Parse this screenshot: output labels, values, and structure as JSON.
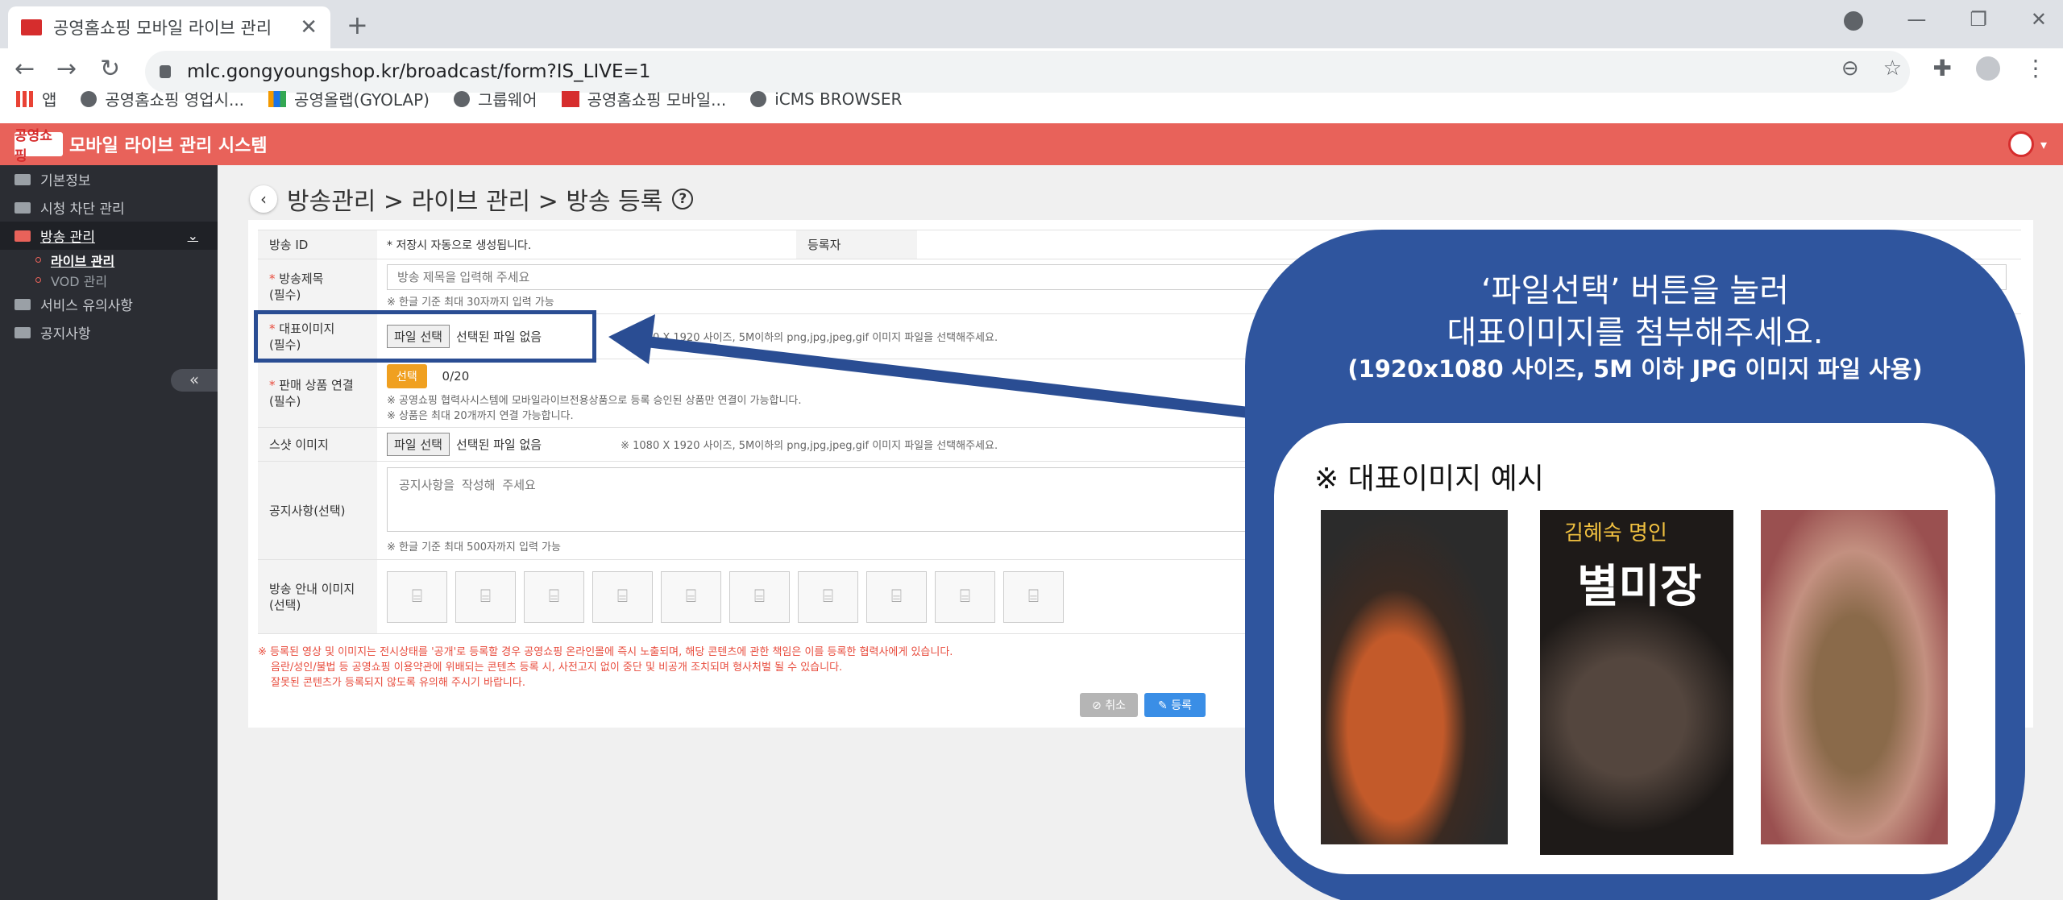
{
  "browser": {
    "tab_title": "공영홈쇼핑 모바일 라이브 관리",
    "tab_close": "✕",
    "new_tab": "+",
    "url_host": "mlc.gongyoungshop.kr",
    "url_path": "/broadcast/form?IS_LIVE=1",
    "bookmarks": [
      "앱",
      "공영홈쇼핑 영업시...",
      "공영올랩(GYOLAP)",
      "그룹웨어",
      "공영홈쇼핑 모바일...",
      "iCMS BROWSER"
    ]
  },
  "app": {
    "logo_text": "공영쇼핑",
    "title": "모바일 라이브 관리 시스템"
  },
  "sidebar": {
    "items": [
      {
        "label": "기본정보"
      },
      {
        "label": "시청 차단 관리"
      },
      {
        "label": "방송 관리",
        "chevron": "⌄"
      },
      {
        "label": "서비스 유의사항"
      },
      {
        "label": "공지사항"
      }
    ],
    "sub_items": [
      {
        "label": "라이브 관리"
      },
      {
        "label": "VOD 관리"
      }
    ],
    "collapse": "«"
  },
  "breadcrumb": "방송관리 > 라이브 관리 > 방송 등록",
  "form": {
    "broadcast_id_label": "방송 ID",
    "broadcast_id_value": "* 저장시 자동으로 생성됩니다.",
    "registrant_label": "등록자",
    "title_label_req": "*",
    "title_label": "방송제목",
    "title_label_2": "(필수)",
    "title_placeholder": "방송 제목을 입력해 주세요",
    "title_hint": "※ 한글 기준 최대 30자까지 입력 가능",
    "rep_img_label": "대표이미지",
    "rep_img_label_2": "(필수)",
    "file_button": "파일 선택",
    "no_file": "선택된 파일 없음",
    "file_hint": "※ 1080 X 1920 사이즈, 5M이하의 png,jpg,jpeg,gif 이미지 파일을 선택해주세요.",
    "product_label": "판매 상품 연결",
    "product_label_2": "(필수)",
    "select_button": "선택",
    "product_count": "0/20",
    "product_hint_1": "※ 공영쇼핑 협력사시스템에 모바일라이브전용상품으로 등록 승인된 상품만 연결이 가능합니다.",
    "product_hint_2": "※ 상품은 최대 20개까지 연결 가능합니다.",
    "snapshot_label": "스샷 이미지",
    "notice_label": "공지사항(선택)",
    "notice_placeholder": "공지사항을 작성해 주세요",
    "notice_hint": "※ 한글 기준 최대 500자까지 입력 가능",
    "guide_img_label": "방송 안내 이미지",
    "guide_img_label_2": "(선택)"
  },
  "notice_lines": [
    "※ 등록된 영상 및 이미지는 전시상태를 '공개'로 등록할 경우 공영쇼핑 온라인몰에 즉시 노출되며, 해당 콘텐츠에 관한 책임은 이를 등록한 협력사에게 있습니다.",
    "음란/성인/불법 등 공영쇼핑 이용약관에 위배되는 콘텐츠 등록 시, 사전고지 없이 중단 및 비공개 조치되며 형사처벌 될 수 있습니다.",
    "잘못된 콘텐츠가 등록되지 않도록 유의해 주시기 바랍니다."
  ],
  "buttons": {
    "cancel": "⊘ 취소",
    "submit": "✎ 등록"
  },
  "callout": {
    "line1": "‘파일선택’ 버튼을 눌러",
    "line2": "대표이미지를 첨부해주세요.",
    "sub": "(1920x1080 사이즈, 5M 이하 JPG 이미지 파일 사용)",
    "example_title": "※ 대표이미지 예시",
    "example_brand": "김혜숙 명인",
    "example_product": "별미장"
  },
  "colors": {
    "header": "#e8625a",
    "sidebar": "#2b2d33",
    "callout": "#2f559e",
    "primary": "#3a8ee6"
  }
}
